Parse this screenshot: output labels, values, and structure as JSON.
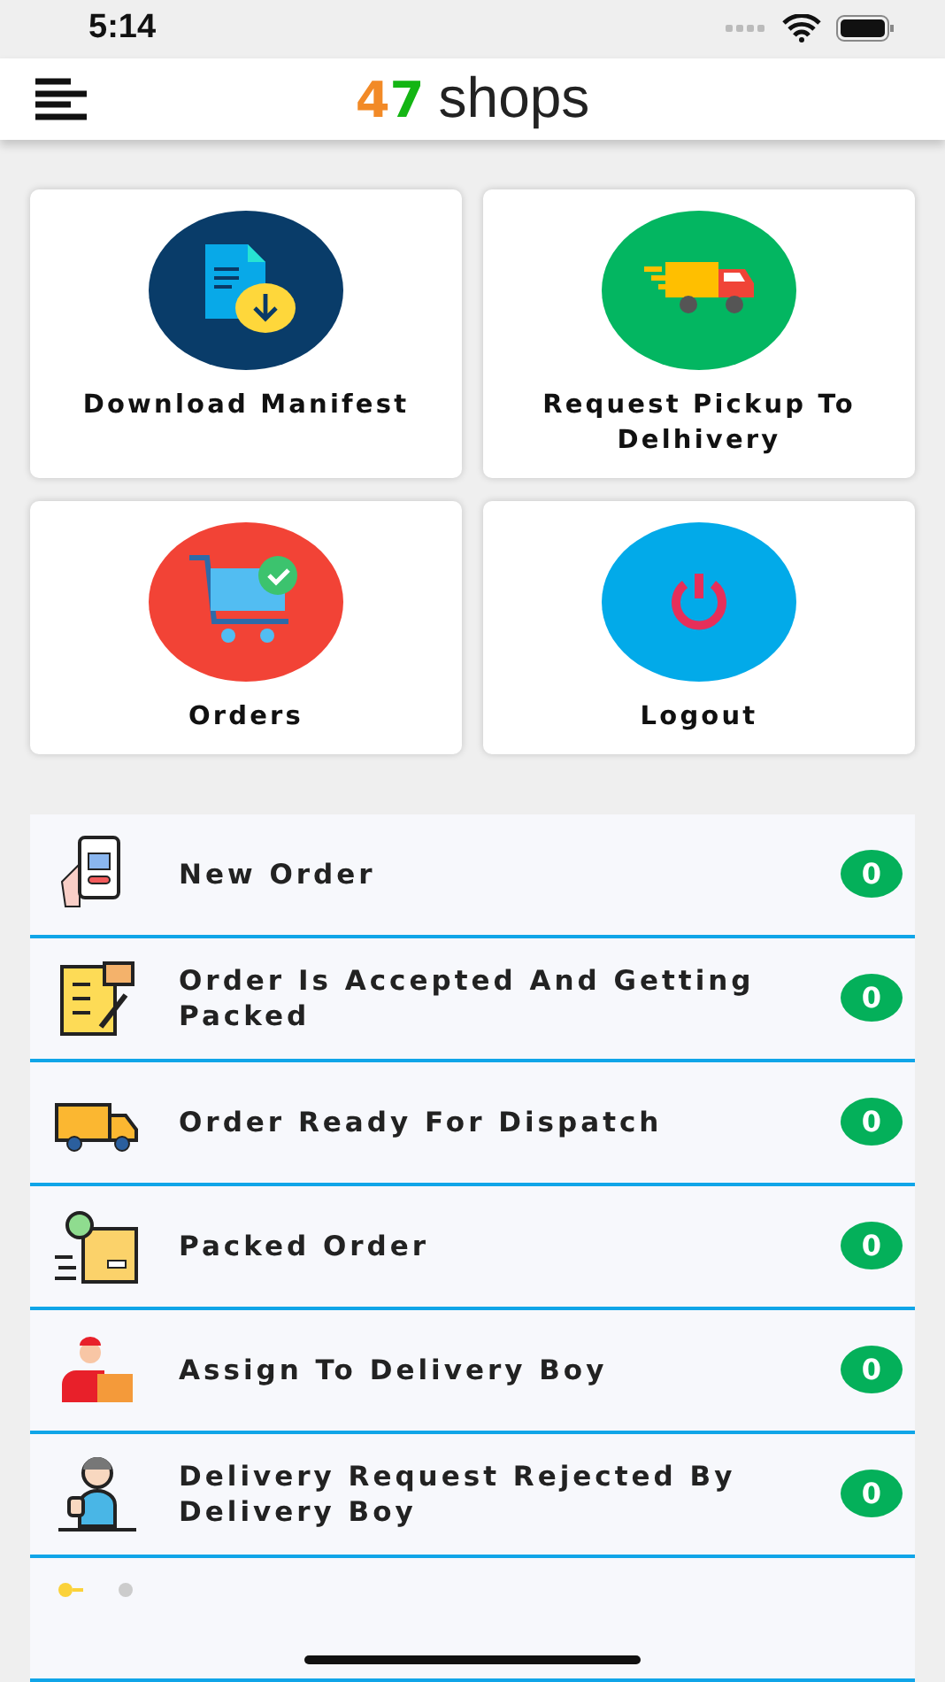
{
  "status_bar": {
    "time": "5:14"
  },
  "header": {
    "logo_number": "47",
    "logo_word": "shops"
  },
  "tiles": [
    {
      "label": "Download Manifest",
      "kind": "manifest",
      "color": "#093c69"
    },
    {
      "label": "Request Pickup To Delhivery",
      "kind": "pickup",
      "color": "#03b661"
    },
    {
      "label": "Orders",
      "kind": "orders",
      "color": "#f24336"
    },
    {
      "label": "Logout",
      "kind": "logout",
      "color": "#02aae9"
    }
  ],
  "statuses": [
    {
      "label": "New Order",
      "kind": "phone",
      "count": "0"
    },
    {
      "label": "Order Is Accepted And Getting Packed",
      "kind": "checklist",
      "count": "0"
    },
    {
      "label": "Order Ready For Dispatch",
      "kind": "truck",
      "count": "0"
    },
    {
      "label": "Packed Order",
      "kind": "box",
      "count": "0"
    },
    {
      "label": "Assign To Delivery Boy",
      "kind": "courier",
      "count": "0"
    },
    {
      "label": "Delivery Request Rejected By Delivery Boy",
      "kind": "person",
      "count": "0"
    }
  ]
}
